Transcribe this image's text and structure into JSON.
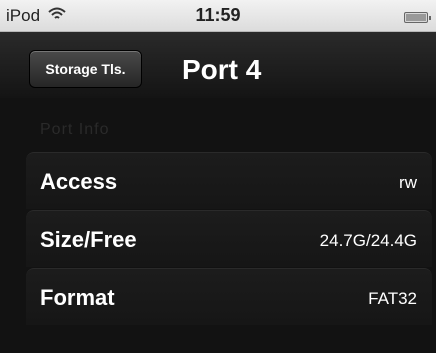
{
  "status_bar": {
    "carrier": "iPod",
    "time": "11:59"
  },
  "nav": {
    "back_label": "Storage Tls.",
    "title": "Port 4"
  },
  "section_header": "Port Info",
  "rows": [
    {
      "label": "Access",
      "value": "rw"
    },
    {
      "label": "Size/Free",
      "value": "24.7G/24.4G"
    },
    {
      "label": "Format",
      "value": "FAT32"
    }
  ]
}
